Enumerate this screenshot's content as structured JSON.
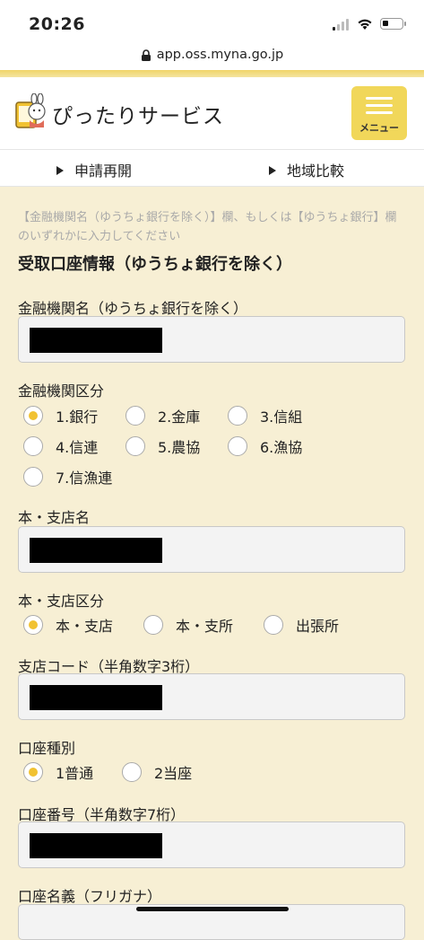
{
  "status": {
    "time": "20:26"
  },
  "browser": {
    "url": "app.oss.myna.go.jp"
  },
  "header": {
    "site_name": "ぴったりサービス",
    "menu_label": "メニュー"
  },
  "nav": {
    "resume": "申請再開",
    "compare": "地域比較"
  },
  "form": {
    "note": "【金融機関名（ゆうちょ銀行を除く）】欄、もしくは【ゆうちょ銀行】欄のいずれかに入力してください",
    "section_title": "受取口座情報（ゆうちょ銀行を除く）",
    "bank_name": {
      "label": "金融機関名（ゆうちょ銀行を除く）"
    },
    "bank_type": {
      "label": "金融機関区分",
      "options": [
        "1.銀行",
        "2.金庫",
        "3.信組",
        "4.信連",
        "5.農協",
        "6.漁協",
        "7.信漁連"
      ],
      "selected": "1.銀行"
    },
    "branch_name": {
      "label": "本・支店名"
    },
    "branch_type": {
      "label": "本・支店区分",
      "options": [
        "本・支店",
        "本・支所",
        "出張所"
      ],
      "selected": "本・支店"
    },
    "branch_code": {
      "label": "支店コード（半角数字3桁）"
    },
    "account_type": {
      "label": "口座種別",
      "options": [
        "1普通",
        "2当座"
      ],
      "selected": "1普通"
    },
    "account_number": {
      "label": "口座番号（半角数字7桁）"
    },
    "account_holder": {
      "label": "口座名義（フリガナ）"
    }
  },
  "colors": {
    "page_bg": "#f7efd4",
    "accent": "#f1d75a",
    "radio_selected": "#f1c232"
  }
}
